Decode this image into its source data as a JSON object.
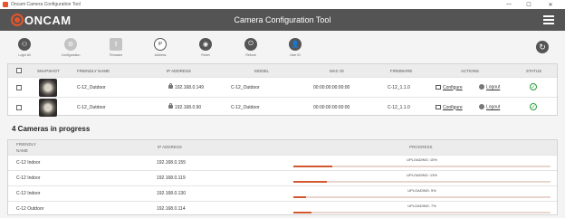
{
  "window": {
    "title": "Oncam Camera Configuration Tool"
  },
  "header": {
    "logo_text": "ONCAM",
    "title": "Camera Configuration Tool"
  },
  "toolbar": {
    "items": [
      {
        "label": "Login All",
        "icon": "login-all-icon",
        "enabled": true
      },
      {
        "label": "Configuration",
        "icon": "gear-icon",
        "enabled": false
      },
      {
        "label": "Firmware",
        "icon": "upload-icon",
        "enabled": false
      },
      {
        "label": "Address",
        "icon": "ip-address-icon",
        "enabled": true
      },
      {
        "label": "Reset",
        "icon": "reset-icon",
        "enabled": true
      },
      {
        "label": "Reboot",
        "icon": "power-icon",
        "enabled": true
      },
      {
        "label": "User ID",
        "icon": "user-id-icon",
        "enabled": true
      }
    ]
  },
  "cameras": {
    "columns": [
      "SNAPSHOT",
      "FRIENDLY NAME",
      "IP ADDRESS",
      "MODEL",
      "MAC ID",
      "FIRMWARE",
      "ACTIONS",
      "STATUS"
    ],
    "rows": [
      {
        "name": "C-12_Outdoor",
        "ip": "192.168.0.149",
        "model": "C-12_Outdoor",
        "mac": "00:00:00:00:00:00",
        "firmware": "C-12_1.1.0",
        "configure": "Configure",
        "logout": "Logout"
      },
      {
        "name": "C-12_Outdoor",
        "ip": "192.168.0.90",
        "model": "C-12_Outdoor",
        "mac": "00:00:00:00:00:00",
        "firmware": "C-12_1.1.0",
        "configure": "Configure",
        "logout": "Logout"
      }
    ]
  },
  "progress": {
    "title": "4 Cameras in progress",
    "columns": {
      "name_line1": "FRIENDLY",
      "name_line2": "NAME",
      "ip": "IP ADDRESS",
      "progress": "PROGRESS"
    },
    "rows": [
      {
        "name": "C-12 Indoor",
        "ip": "192.168.0.155",
        "status": "UPLOADING: 15%",
        "percent": 15
      },
      {
        "name": "C-12 Indoor",
        "ip": "192.168.0.119",
        "status": "UPLOADING: 13%",
        "percent": 13
      },
      {
        "name": "C-12 Indoor",
        "ip": "192.168.0.130",
        "status": "UPLOADING: 5%",
        "percent": 5
      },
      {
        "name": "C-12 Outdoor",
        "ip": "192.168.0.114",
        "status": "UPLOADING: 7%",
        "percent": 7
      }
    ]
  },
  "colors": {
    "accent": "#d1582e",
    "header_bg": "#545454",
    "ok": "#2e9e3c"
  }
}
